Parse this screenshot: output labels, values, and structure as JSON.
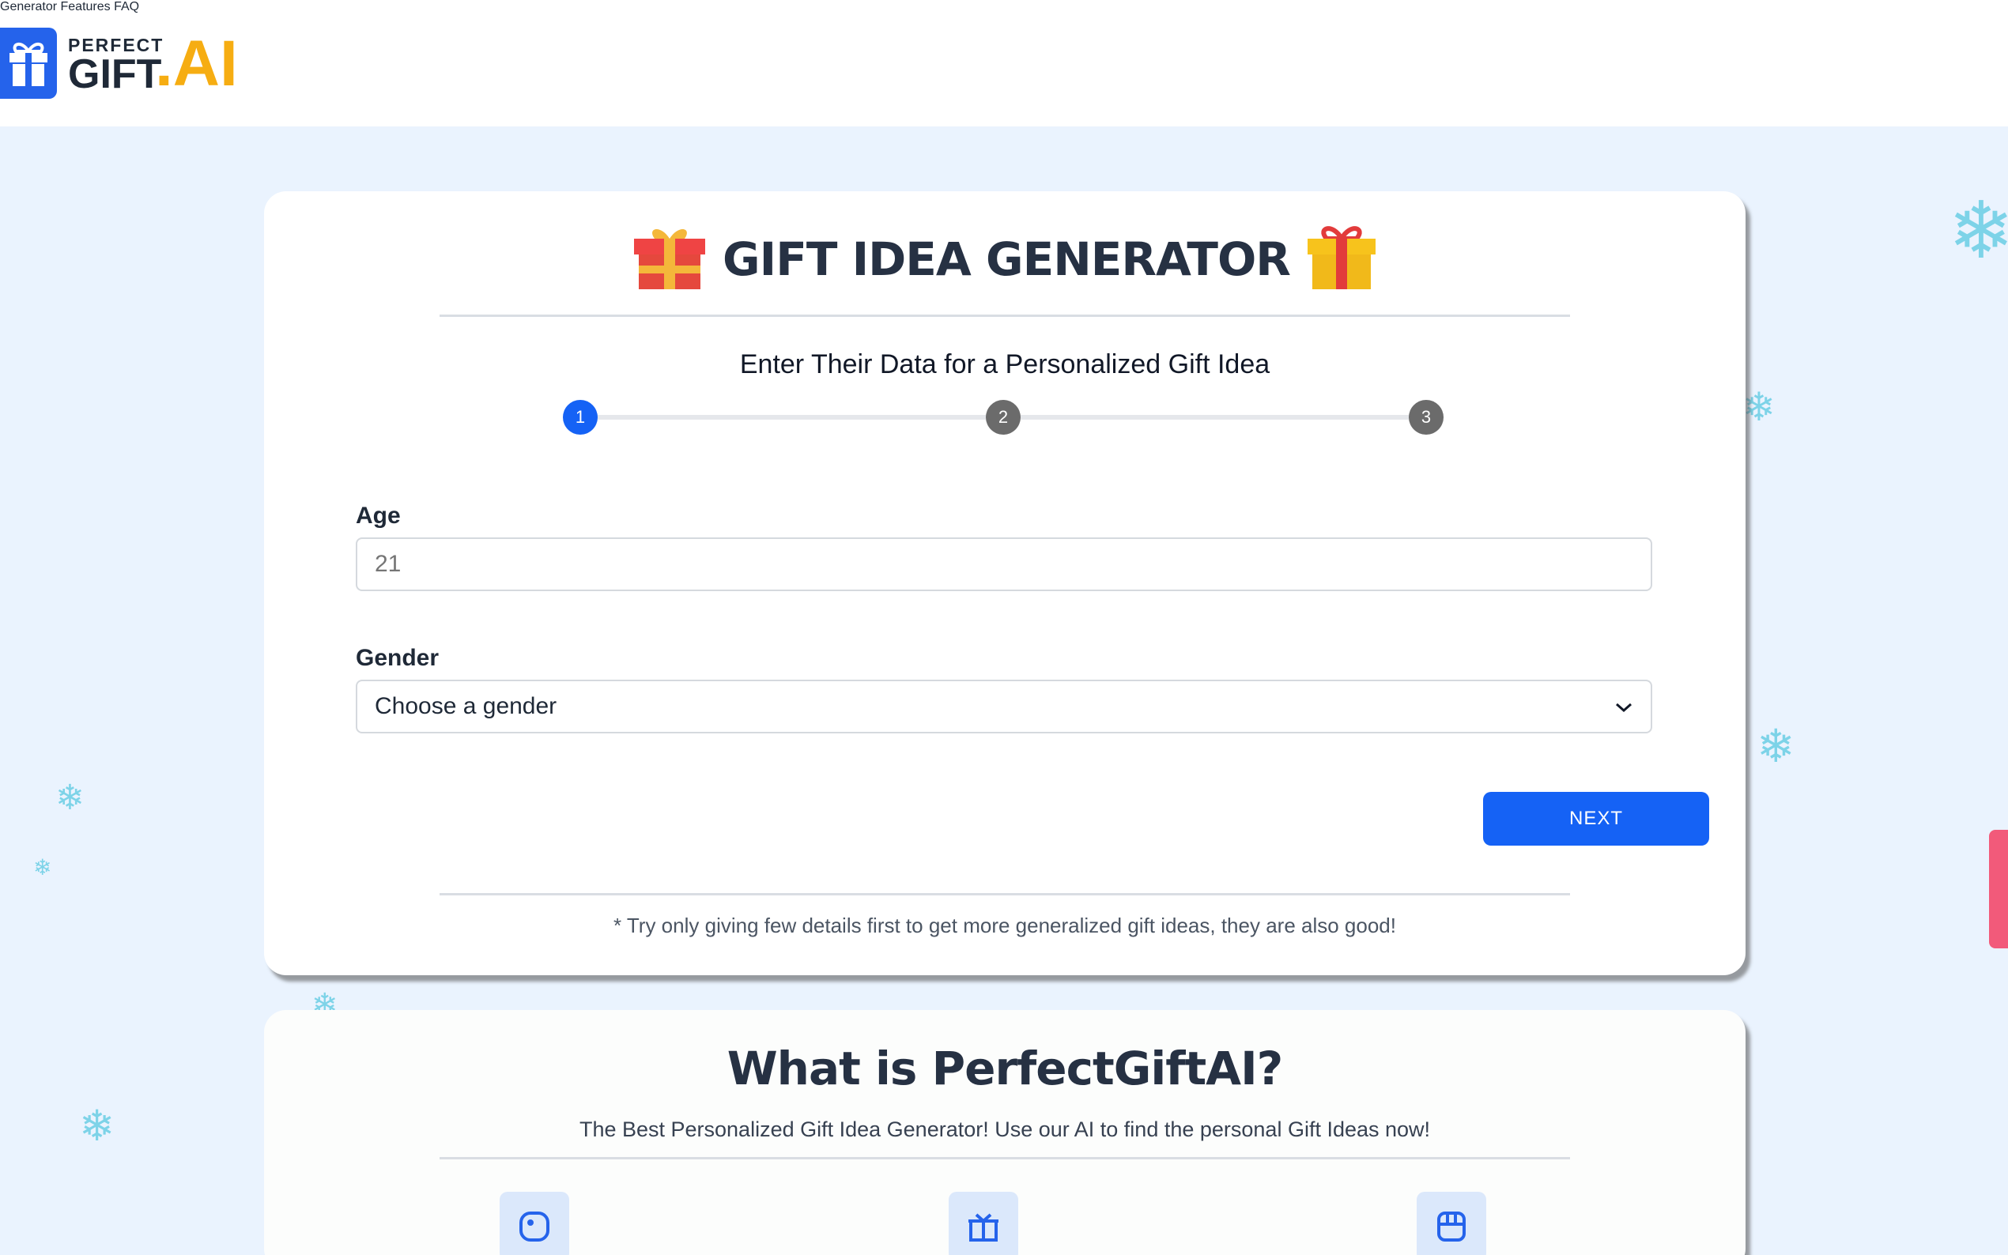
{
  "header": {
    "logo": {
      "perfect": "PERFECT",
      "gift": "GIFT",
      "ai": ".AI"
    },
    "nav": [
      "Generator",
      "Features",
      "FAQ"
    ]
  },
  "generator": {
    "title": "GIFT IDEA GENERATOR",
    "subtitle": "Enter Their Data for a Personalized Gift Idea",
    "steps": [
      {
        "label": "1",
        "active": true
      },
      {
        "label": "2",
        "active": false
      },
      {
        "label": "3",
        "active": false
      }
    ],
    "age": {
      "label": "Age",
      "placeholder": "21",
      "value": ""
    },
    "gender": {
      "label": "Gender",
      "selected": "Choose a gender"
    },
    "next_label": "NEXT",
    "note": "* Try only giving few details first to get more generalized gift ideas, they are also good!"
  },
  "about": {
    "title": "What is PerfectGiftAI?",
    "subtitle": "The Best Personalized Gift Idea Generator! Use our AI to find the personal Gift Ideas now!",
    "feature_icons": [
      "tag-icon",
      "gift-basket-icon",
      "storefront-icon"
    ]
  },
  "colors": {
    "accent": "#1562f5",
    "logo_blue": "#2563eb",
    "logo_gold": "#f6ad12",
    "background": "#eaf3fe",
    "step_inactive": "#6b6b6b",
    "snowflake": "#7dd3e8"
  }
}
